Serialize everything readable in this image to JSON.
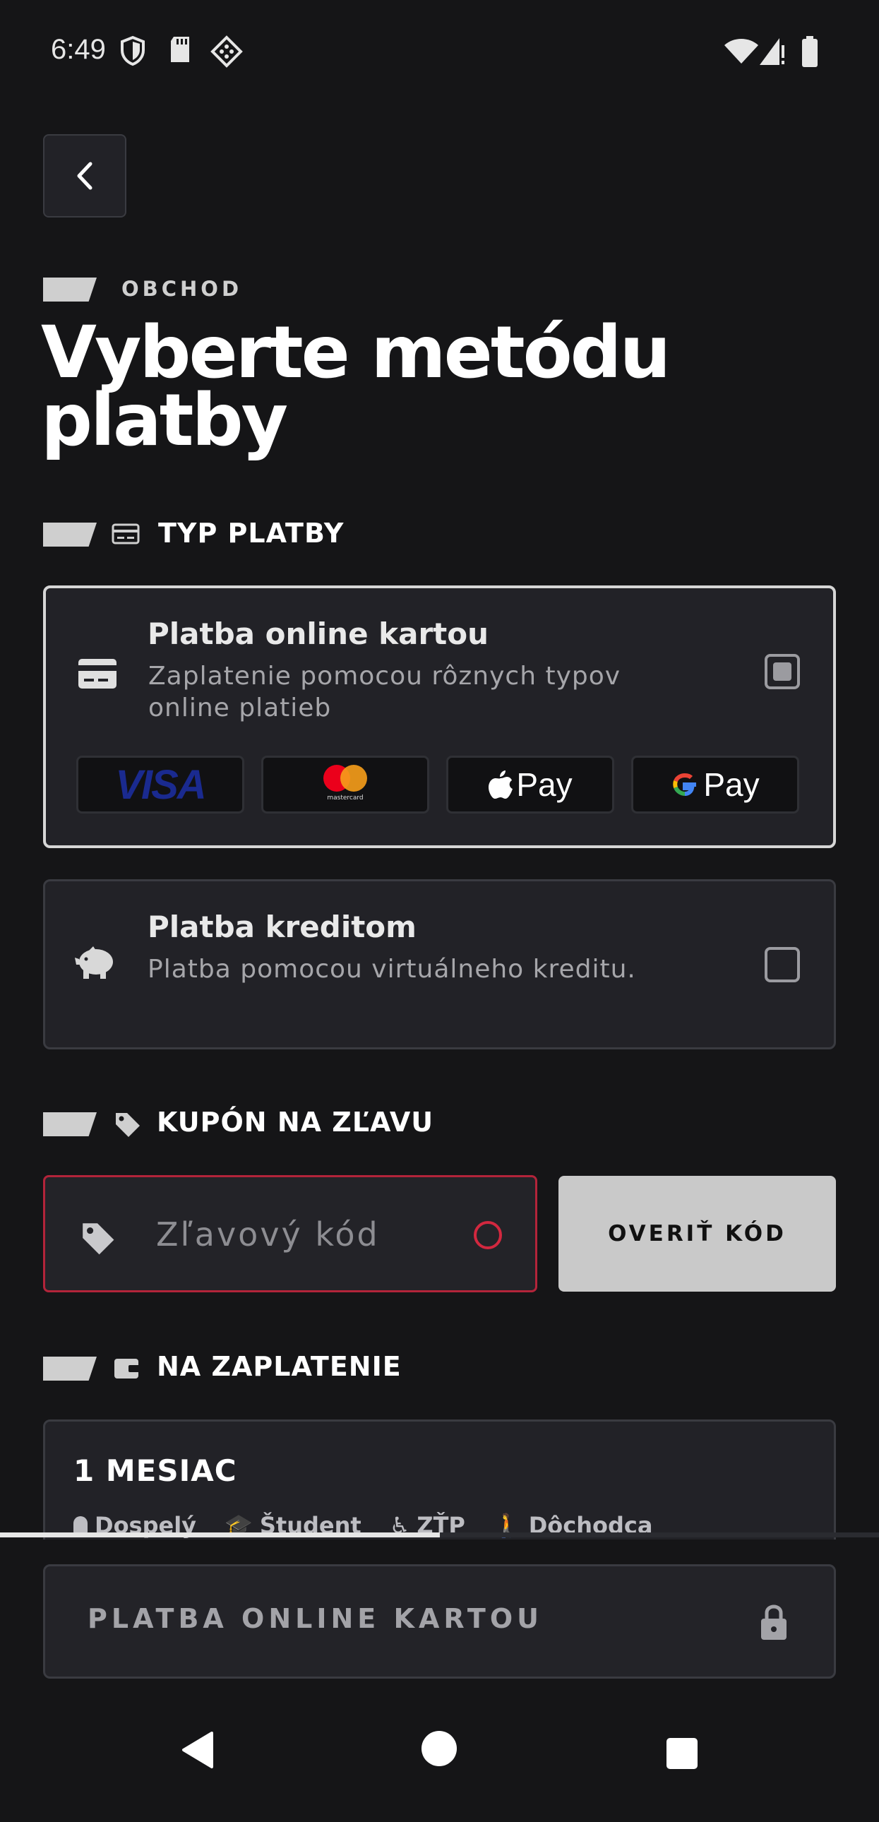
{
  "status_bar": {
    "time": "6:49"
  },
  "header": {
    "eyebrow": "OBCHOD",
    "title": "Vyberte metódu platby"
  },
  "payment_type": {
    "section_label": "TYP PLATBY",
    "options": [
      {
        "title": "Platba online kartou",
        "description": "Zaplatenie pomocou rôznych typov online platieb",
        "selected": true
      },
      {
        "title": "Platba kreditom",
        "description": "Platba pomocou virtuálneho kreditu.",
        "selected": false
      }
    ],
    "logos": [
      "VISA",
      "mastercard",
      "Pay",
      "Pay"
    ]
  },
  "coupon": {
    "section_label": "KUPÓN NA ZĽAVU",
    "placeholder": "Zľavový kód",
    "verify_label": "OVERIŤ KÓD"
  },
  "to_pay": {
    "section_label": "NA ZAPLATENIE",
    "item_title": "1 MESIAC",
    "tariffs": [
      "Dospelý",
      "Študent",
      "ZŤP",
      "Dôchodca"
    ]
  },
  "scroll_progress": 0.5,
  "cta": {
    "label": "PLATBA ONLINE KARTOU"
  },
  "colors": {
    "background": "#151517",
    "card": "#222227",
    "error": "#b3243a",
    "accent_button": "#c9c9c9"
  }
}
